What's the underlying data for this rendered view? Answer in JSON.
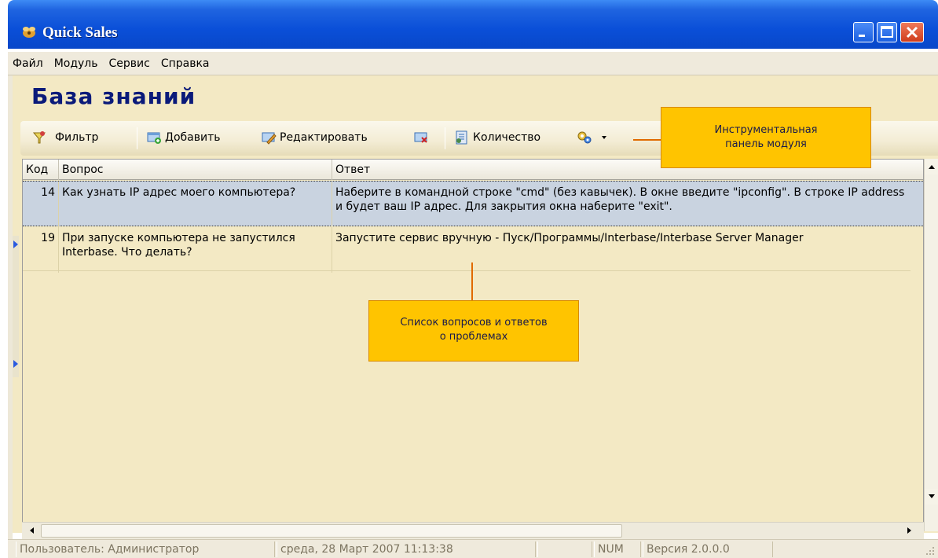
{
  "window": {
    "title": "Quick Sales"
  },
  "menu": [
    "Файл",
    "Модуль",
    "Сервис",
    "Справка"
  ],
  "module": {
    "title": "База знаний"
  },
  "toolbar": {
    "filter": "Фильтр",
    "add": "Добавить",
    "edit": "Редактировать",
    "count": "Количество"
  },
  "table": {
    "columns": [
      "Код",
      "Вопрос",
      "Ответ"
    ],
    "rows": [
      {
        "code": "14",
        "question": "Как узнать IP адрес моего компьютера?",
        "answer": "Наберите в командной строке \"cmd\" (без кавычек). В окне введите \"ipconfig\". В строке IP address и будет ваш IP адрес. Для закрытия окна наберите \"exit\"."
      },
      {
        "code": "19",
        "question": "При запуске компьютера не запустился Interbase. Что делать?",
        "answer": "Запустите сервис вручную - Пуск/Программы/Interbase/Interbase Server Manager"
      }
    ]
  },
  "callouts": {
    "toolbar_line1": "Инструментальная",
    "toolbar_line2": "панель модуля",
    "list_line1": "Список вопросов и ответов",
    "list_line2": "о проблемах"
  },
  "status": {
    "user": "Пользователь: Администратор",
    "datetime": "среда, 28 Март 2007 11:13:38",
    "num": "NUM",
    "version": "Версия 2.0.0.0"
  }
}
